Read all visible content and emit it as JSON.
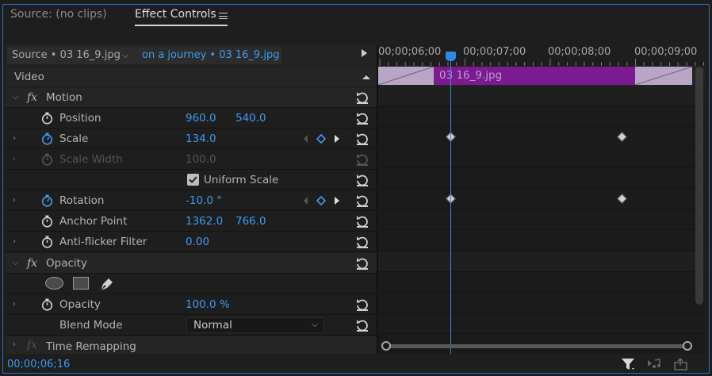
{
  "tabs": {
    "source": "Source: (no clips)",
    "effect_controls": "Effect Controls"
  },
  "source_row": {
    "source_clip": "Source • 03 16_9.jpg",
    "sequence_clip": "on a journey • 03 16_9.jpg"
  },
  "timeline": {
    "timecodes": [
      "00;00;06;00",
      "00;00;07;00",
      "00;00;08;00",
      "00;00;09;00"
    ],
    "clip_name": "03 16_9.jpg"
  },
  "video_header": "Video",
  "motion": {
    "label": "Motion",
    "position": {
      "label": "Position",
      "x": "960.0",
      "y": "540.0"
    },
    "scale": {
      "label": "Scale",
      "value": "134.0"
    },
    "scale_width": {
      "label": "Scale Width",
      "value": "100.0"
    },
    "uniform_scale": {
      "label": "Uniform Scale",
      "checked": true
    },
    "rotation": {
      "label": "Rotation",
      "value": "-10.0 °"
    },
    "anchor_point": {
      "label": "Anchor Point",
      "x": "1362.0",
      "y": "766.0"
    },
    "anti_flicker": {
      "label": "Anti-flicker Filter",
      "value": "0.00"
    }
  },
  "opacity": {
    "label": "Opacity",
    "opacity_prop": {
      "label": "Opacity",
      "value": "100.0 %"
    },
    "blend_mode": {
      "label": "Blend Mode",
      "value": "Normal"
    }
  },
  "time_remapping": {
    "label": "Time Remapping"
  },
  "footer": {
    "timecode": "00;00;06;16"
  },
  "colors": {
    "accent": "#3e9bf2",
    "clip": "#7b1b90",
    "playhead": "#2f8ae6"
  }
}
